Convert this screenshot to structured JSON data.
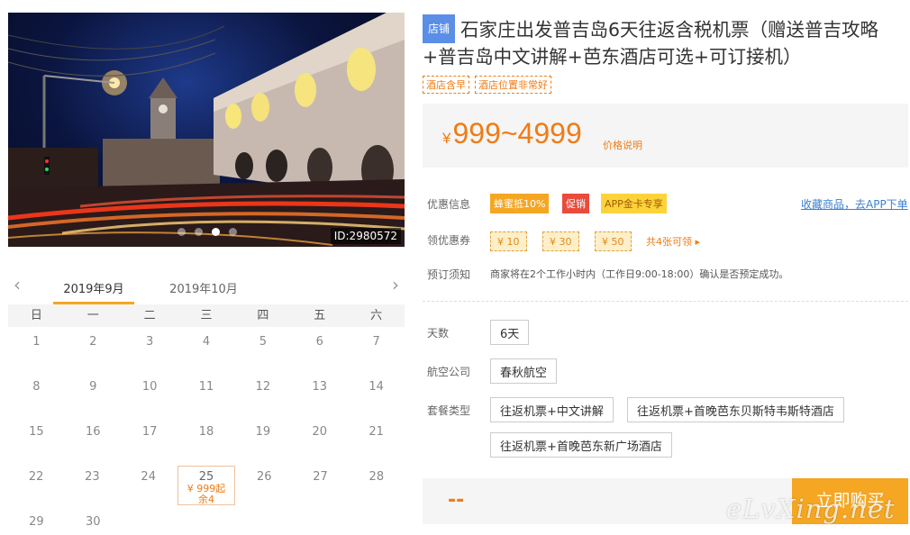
{
  "hero": {
    "image_id": "ID:2980572",
    "slides": 4,
    "active_slide": 3
  },
  "calendar": {
    "tabs": [
      "2019年9月",
      "2019年10月"
    ],
    "weekdays": [
      "日",
      "一",
      "二",
      "三",
      "四",
      "五",
      "六"
    ],
    "rows": [
      [
        "1",
        "2",
        "3",
        "4",
        "5",
        "6",
        "7"
      ],
      [
        "8",
        "9",
        "10",
        "11",
        "12",
        "13",
        "14"
      ],
      [
        "15",
        "16",
        "17",
        "18",
        "19",
        "20",
        "21"
      ],
      [
        "22",
        "23",
        "24",
        "25",
        "26",
        "27",
        "28"
      ],
      [
        "29",
        "30",
        "",
        "",
        "",
        "",
        ""
      ]
    ],
    "selected_day": {
      "day": "25",
      "price": "¥ 999起",
      "remaining": "余4"
    }
  },
  "product": {
    "shop_tag": "店铺",
    "title": "石家庄出发普吉岛6天往返含税机票（赠送普吉攻略+普吉岛中文讲解+芭东酒店可选+可订接机）",
    "tags": [
      "酒店含早",
      "酒店位置非常好"
    ],
    "price_symbol": "¥",
    "price": "999~4999",
    "price_explain": "价格说明"
  },
  "promo": {
    "label": "优惠信息",
    "badges": [
      "蜂蜜抵10%",
      "促销",
      "APP金卡专享"
    ],
    "app_link": "收藏商品，去APP下单"
  },
  "coupons": {
    "label": "领优惠券",
    "items": [
      "¥ 10",
      "¥ 30",
      "¥ 50"
    ],
    "all_text": "共4张可领 ▸"
  },
  "booking": {
    "label": "预订须知",
    "text": "商家将在2个工作小时内（工作日9:00-18:00）确认是否预定成功。"
  },
  "options": {
    "days_label": "天数",
    "days": [
      "6天"
    ],
    "airline_label": "航空公司",
    "airlines": [
      "春秋航空"
    ],
    "package_label": "套餐类型",
    "packages": [
      "往返机票+中文讲解",
      "往返机票+首晚芭东贝斯特韦斯特酒店",
      "往返机票+首晚芭东新广场酒店"
    ]
  },
  "buy": {
    "price_placeholder": "--",
    "button": "立即购买",
    "watermark": "eLvXing.net"
  },
  "colors": {
    "accent": "#f07b16",
    "buy_button": "#f5a623",
    "link": "#3b7fd1",
    "shop_tag": "#5b8ee6"
  }
}
